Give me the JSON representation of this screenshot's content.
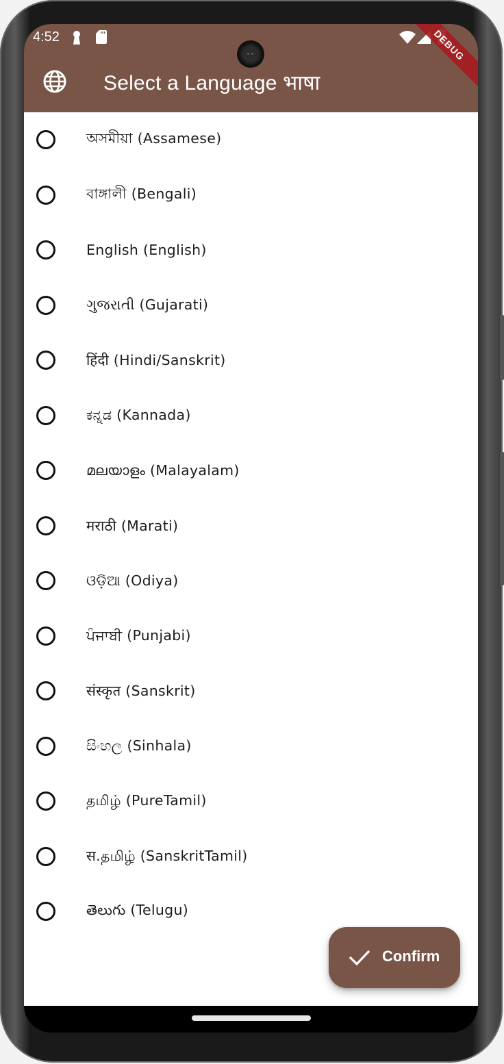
{
  "status_bar": {
    "time": "4:52",
    "left_icons": [
      "keyhole-icon",
      "sd-card-icon"
    ],
    "right_icons": [
      "wifi-icon",
      "cell-signal-icon",
      "battery-icon"
    ]
  },
  "debug_banner": "DEBUG",
  "app_bar": {
    "leading_icon": "globe-icon",
    "title": "Select a Language भाषा",
    "background_color": "#795548"
  },
  "languages": [
    {
      "label": "অসমীয়া (Assamese)",
      "selected": false
    },
    {
      "label": "বাঙ্গালী (Bengali)",
      "selected": false
    },
    {
      "label": "English (English)",
      "selected": false
    },
    {
      "label": "ગુજરાતી (Gujarati)",
      "selected": false
    },
    {
      "label": "हिंदी (Hindi/Sanskrit)",
      "selected": false
    },
    {
      "label": "ಕನ್ನಡ (Kannada)",
      "selected": false
    },
    {
      "label": "മലയാളം (Malayalam)",
      "selected": false
    },
    {
      "label": "मराठी (Marati)",
      "selected": false
    },
    {
      "label": "ଓଡ଼ିଆ  (Odiya)",
      "selected": false
    },
    {
      "label": "ਪੰਜਾਬੀ (Punjabi)",
      "selected": false
    },
    {
      "label": "संस्कृत (Sanskrit)",
      "selected": false
    },
    {
      "label": "සිංහල (Sinhala)",
      "selected": false
    },
    {
      "label": "தமிழ் (PureTamil)",
      "selected": false
    },
    {
      "label": "स.தமிழ் (SanskritTamil)",
      "selected": false
    },
    {
      "label": "తెలుగు (Telugu)",
      "selected": false
    }
  ],
  "fab": {
    "icon": "check-icon",
    "label": "Confirm",
    "color": "#795548"
  }
}
